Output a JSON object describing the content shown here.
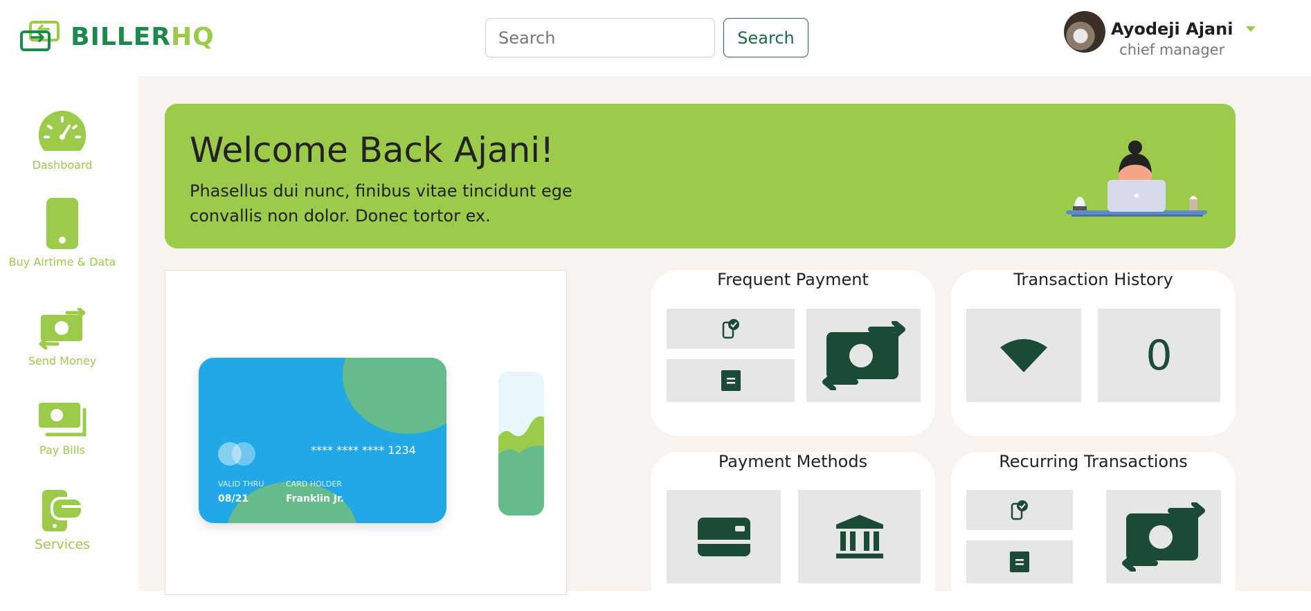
{
  "app": {
    "logo_part1": "BILLER",
    "logo_part2": "HQ"
  },
  "header": {
    "search_placeholder": "Search",
    "search_button": "Search",
    "user_name": "Ayodeji Ajani",
    "user_role": "chief manager"
  },
  "sidebar": {
    "items": [
      {
        "label": "Dashboard",
        "icon": "gauge-icon"
      },
      {
        "label": "Buy Airtime & Data",
        "icon": "phone-icon"
      },
      {
        "label": "Send Money",
        "icon": "money-transfer-icon"
      },
      {
        "label": "Pay Bills",
        "icon": "bills-icon"
      },
      {
        "label": "Services",
        "icon": "services-icon"
      }
    ]
  },
  "banner": {
    "title": "Welcome Back Ajani!",
    "subtitle": "Phasellus dui nunc, finibus vitae tincidunt ege convallis non dolor. Donec tortor ex."
  },
  "card": {
    "number": "**** **** **** 1234",
    "valid_label": "VALID THRU",
    "valid_value": "08/21",
    "holder_label": "CARD HOLDER",
    "holder_value": "Franklin Jr."
  },
  "tiles": {
    "frequent_payment": "Frequent Payment",
    "transaction_history": "Transaction History",
    "transaction_count": "0",
    "payment_methods": "Payment Methods",
    "recurring_transactions": "Recurring Transactions"
  },
  "colors": {
    "brand_green": "#9cca4b",
    "dark_green": "#1b4a36",
    "card_blue": "#22a8e6"
  }
}
